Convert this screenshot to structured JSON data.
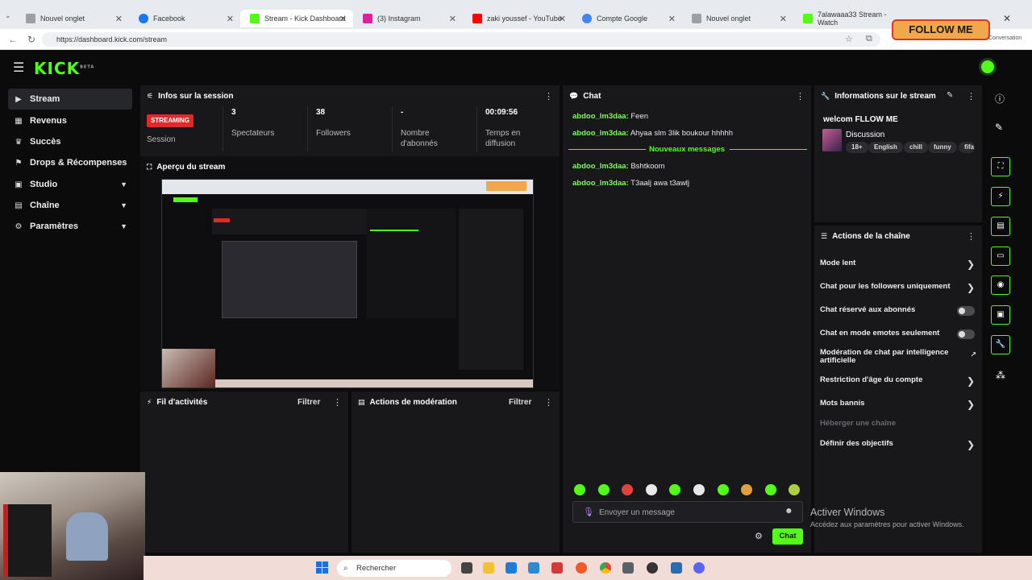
{
  "browser": {
    "tabs": [
      {
        "label": "Nouvel onglet",
        "color": "#9aa0a6"
      },
      {
        "label": "Facebook",
        "color": "#1877f2"
      },
      {
        "label": "Stream - Kick Dashboard",
        "color": "#53fc18"
      },
      {
        "label": "(3) Instagram",
        "color": "#d6249f"
      },
      {
        "label": "zaki youssef - YouTube",
        "color": "#ff0000"
      },
      {
        "label": "Compte Google",
        "color": "#4285f4"
      },
      {
        "label": "Nouvel onglet",
        "color": "#9aa0a6"
      },
      {
        "label": "7alawaaa33 Stream - Watch",
        "color": "#53fc18"
      }
    ],
    "url": "https://dashboard.kick.com/stream",
    "overlay_text": "FOLLOW ME",
    "overlay_small": "Conversation"
  },
  "app": {
    "logo": "KICK",
    "logo_sup": "BETA"
  },
  "sidebar": {
    "items": [
      {
        "label": "Stream",
        "icon": "stream-icon",
        "glyph": "▶"
      },
      {
        "label": "Revenus",
        "icon": "revenue-icon",
        "glyph": "▦"
      },
      {
        "label": "Succès",
        "icon": "trophy-icon",
        "glyph": "♛"
      },
      {
        "label": "Drops & Récompenses",
        "icon": "gift-icon",
        "glyph": "⚑"
      },
      {
        "label": "Studio",
        "icon": "studio-icon",
        "glyph": "▣"
      },
      {
        "label": "Chaîne",
        "icon": "channel-icon",
        "glyph": "▤"
      },
      {
        "label": "Paramètres",
        "icon": "gear-icon",
        "glyph": "⚙"
      }
    ]
  },
  "session": {
    "title": "Infos sur la session",
    "badge": "STREAMING",
    "session_label": "Session",
    "stats": [
      {
        "value": "3",
        "label": "Spectateurs"
      },
      {
        "value": "38",
        "label": "Followers"
      },
      {
        "value": "-",
        "label": "Nombre d'abonnés"
      },
      {
        "value": "00:09:56",
        "label": "Temps en diffusion"
      }
    ]
  },
  "preview": {
    "title": "Aperçu du stream"
  },
  "activity": {
    "title": "Fil d'activités",
    "filter": "Filtrer"
  },
  "moderation": {
    "title": "Actions de modération",
    "filter": "Filtrer"
  },
  "chat": {
    "title": "Chat",
    "messages_before": [
      {
        "user": "abdoo_lm3daa:",
        "text": "Feen"
      },
      {
        "user": "abdoo_lm3daa:",
        "text": "Ahyaa slm 3lik boukour hhhhh"
      }
    ],
    "new_messages_label": "Nouveaux messages",
    "messages_after": [
      {
        "user": "abdoo_lm3daa:",
        "text": "Bshtkoom"
      },
      {
        "user": "abdoo_lm3daa:",
        "text": "T3aalj awa t3awlj"
      }
    ],
    "input_placeholder": "Envoyer un message",
    "send_label": "Chat",
    "emote_colors": [
      "#53fc18",
      "#53fc18",
      "#e0433a",
      "#e8e8e8",
      "#53fc18",
      "#e8e8e8",
      "#53fc18",
      "#e0a040",
      "#53fc18",
      "#a8d040"
    ]
  },
  "stream_info": {
    "title": "Informations sur le stream",
    "stream_title": "welcom FLLOW ME",
    "category": "Discussion",
    "tags": [
      "18+",
      "English",
      "chill",
      "funny",
      "fifa"
    ]
  },
  "channel_actions": {
    "title": "Actions de la chaîne",
    "items": [
      {
        "label": "Mode lent",
        "control": "chevron"
      },
      {
        "label": "Chat pour les followers uniquement",
        "control": "chevron"
      },
      {
        "label": "Chat réservé aux abonnés",
        "control": "toggle"
      },
      {
        "label": "Chat en mode emotes seulement",
        "control": "toggle"
      },
      {
        "label": "Modération de chat par intelligence artificielle",
        "control": "external"
      },
      {
        "label": "Restriction d'âge du compte",
        "control": "chevron"
      },
      {
        "label": "Mots bannis",
        "control": "chevron"
      },
      {
        "label": "Héberger une chaîne",
        "control": "none"
      },
      {
        "label": "Définir des objectifs",
        "control": "chevron"
      }
    ]
  },
  "rail": {
    "icons": [
      "info-icon",
      "edit-icon",
      "fullscreen-icon",
      "lightning-icon",
      "document-icon",
      "chat-bubble-icon",
      "broadcast-icon",
      "camera-icon",
      "wrench-icon",
      "apps-icon"
    ]
  },
  "windows": {
    "activate_title": "Activer Windows",
    "activate_sub": "Accédez aux paramètres pour activer Windows.",
    "search_placeholder": "Rechercher"
  }
}
